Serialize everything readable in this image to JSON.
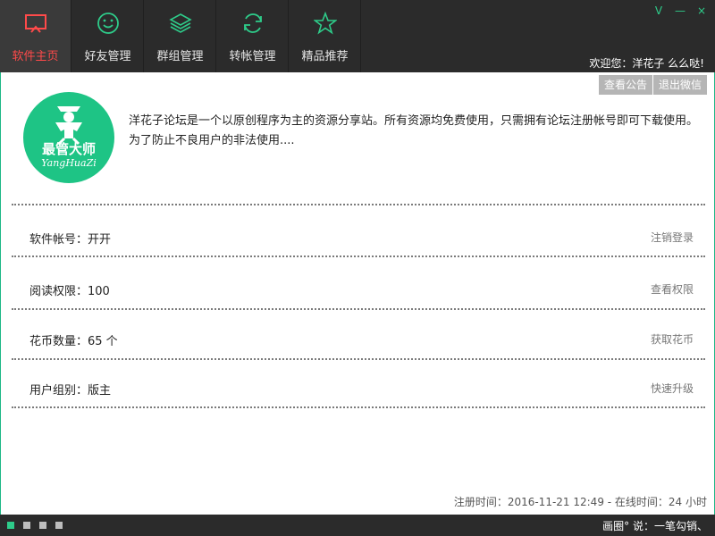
{
  "nav": {
    "tabs": [
      {
        "label": "软件主页",
        "icon": "monitor-icon",
        "active": true
      },
      {
        "label": "好友管理",
        "icon": "smiley-icon",
        "active": false
      },
      {
        "label": "群组管理",
        "icon": "layers-icon",
        "active": false
      },
      {
        "label": "转帐管理",
        "icon": "refresh-icon",
        "active": false
      },
      {
        "label": "精品推荐",
        "icon": "star-icon",
        "active": false
      }
    ]
  },
  "window": {
    "controls": [
      "V",
      "—",
      "×"
    ]
  },
  "header": {
    "welcome": "欢迎您：洋花子 么么哒!"
  },
  "buttons": {
    "view_notice": "查看公告",
    "logout_wechat": "退出微信"
  },
  "logo": {
    "text": "最管大师",
    "subtext": "YangHuaZi"
  },
  "intro": {
    "text": "洋花子论坛是一个以原创程序为主的资源分享站。所有资源均免费使用，只需拥有论坛注册帐号即可下载使用。为了防止不良用户的非法使用...."
  },
  "info_rows": [
    {
      "label": "软件帐号：开开",
      "action": "注销登录"
    },
    {
      "label": "阅读权限：100",
      "action": "查看权限"
    },
    {
      "label": "花币数量：65 个",
      "action": "获取花币"
    },
    {
      "label": "用户组别：版主",
      "action": "快速升级"
    }
  ],
  "footer": {
    "registration": "注册时间：2016-11-21 12:49 - 在线时间：24 小时",
    "status": "画圈°    说：一笔勾销、"
  },
  "colors": {
    "accent": "#1ec485",
    "active_tab_text": "#ff4a4a",
    "topbar": "#2b2b2b"
  }
}
